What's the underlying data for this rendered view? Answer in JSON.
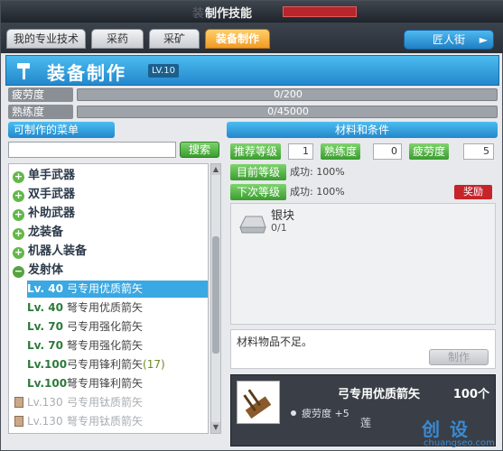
{
  "window": {
    "title": "制作技能",
    "ghost_title": "装备"
  },
  "tabs": [
    {
      "label": "我的专业技术"
    },
    {
      "label": "采药"
    },
    {
      "label": "采矿"
    },
    {
      "label": "装备制作"
    }
  ],
  "tab_button": {
    "label": "匠人街",
    "arrow": "►"
  },
  "header": {
    "title": "装备制作",
    "level": "LV.10"
  },
  "stats": {
    "fatigue": {
      "label": "疲劳度",
      "value": "0/200",
      "fill_fraction": 0
    },
    "proficiency": {
      "label": "熟练度",
      "value": "0/45000",
      "fill_fraction": 0
    }
  },
  "left_panel": {
    "title": "可制作的菜单",
    "search_placeholder": "",
    "search_button": "搜索",
    "categories": [
      {
        "label": "单手武器",
        "expanded": false
      },
      {
        "label": "双手武器",
        "expanded": false
      },
      {
        "label": "补助武器",
        "expanded": false
      },
      {
        "label": "龙装备",
        "expanded": false
      },
      {
        "label": "机器人装备",
        "expanded": false
      },
      {
        "label": "发射体",
        "expanded": true
      }
    ],
    "items": [
      {
        "level": "Lv. 40",
        "name": "弓专用优质箭矢",
        "extra": "",
        "selected": true
      },
      {
        "level": "Lv. 40",
        "name": "弩专用优质箭矢",
        "extra": ""
      },
      {
        "level": "Lv. 70",
        "name": "弓专用强化箭矢",
        "extra": ""
      },
      {
        "level": "Lv. 70",
        "name": "弩专用强化箭矢",
        "extra": ""
      },
      {
        "level": "Lv.100",
        "name": "弓专用锋利箭矢",
        "extra": "(17)"
      },
      {
        "level": "Lv.100",
        "name": "弩专用锋利箭矢",
        "extra": ""
      },
      {
        "level": "Lv.130",
        "name": "弓专用钛质箭矢",
        "extra": "",
        "disabled": true
      },
      {
        "level": "Lv.130",
        "name": "弩专用钛质箭矢",
        "extra": "",
        "disabled": true
      }
    ]
  },
  "right_panel": {
    "title": "材料和条件",
    "requirements": [
      {
        "label": "推荐等级",
        "value": "1"
      },
      {
        "label": "熟练度",
        "value": "0"
      },
      {
        "label": "疲劳度",
        "value": "5"
      }
    ],
    "rows": [
      {
        "label": "目前等级",
        "value": "成功: 100%"
      },
      {
        "label": "下次等级",
        "value": "成功: 100%",
        "badge": "奖励"
      }
    ],
    "material": {
      "name": "银块",
      "count": "0/1"
    },
    "message": "材料物品不足。",
    "make_button": "制作",
    "result": {
      "name": "弓专用优质箭矢",
      "qty": "100个",
      "effect": "疲劳度 +5"
    }
  },
  "watermark": {
    "text1": "莲",
    "logo": "创 设",
    "url": "chuangseo.com"
  },
  "colors": {
    "accent_blue": "#2387cc",
    "tab_active": "#f29a22",
    "green_label": "#3a9c2f",
    "badge_red": "#c5242b"
  }
}
